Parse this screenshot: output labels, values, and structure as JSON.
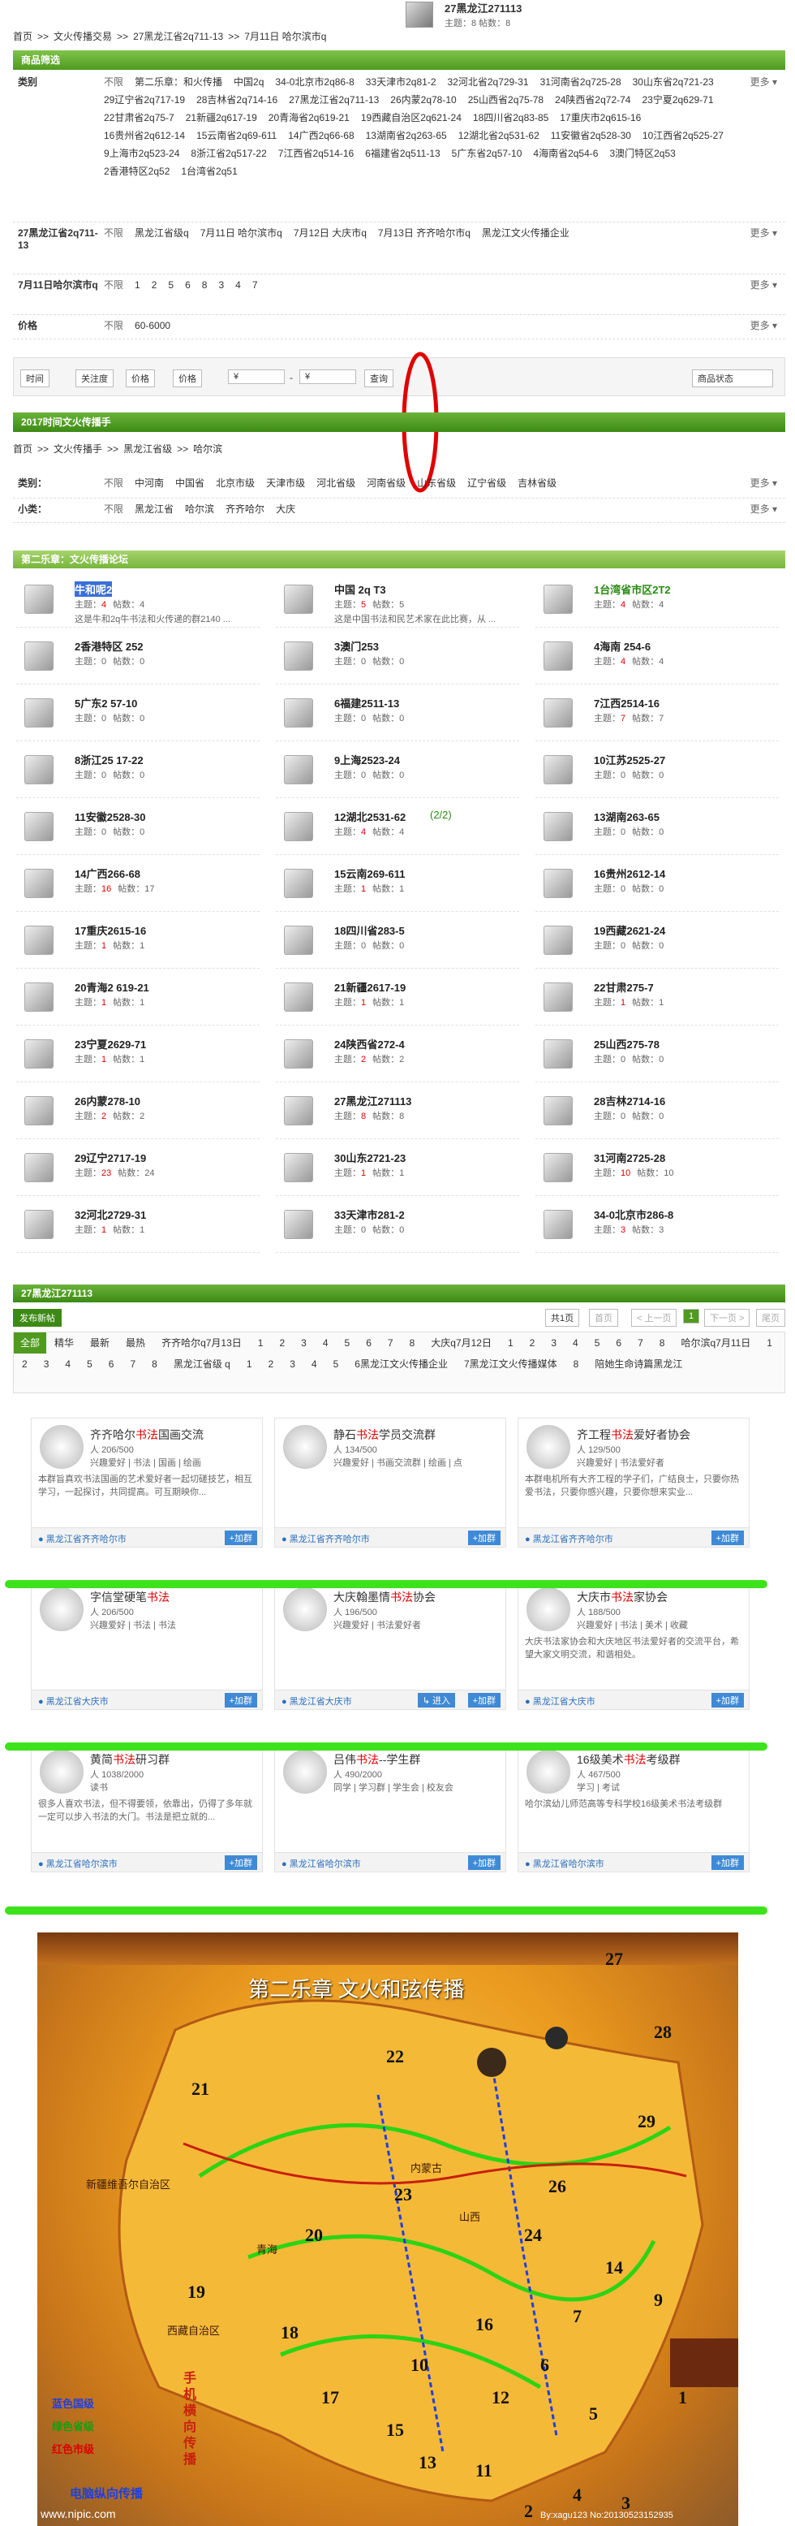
{
  "header": {
    "thread_title": "27黑龙江271113",
    "thread_meta": "主题：8 帖数：8"
  },
  "breadcrumb1": [
    "首页",
    ">>",
    "文火传播交易",
    ">>",
    "27黑龙江省2q711-13",
    ">>",
    "7月11日 哈尔滨市q"
  ],
  "filter_title": "商品筛选",
  "filters": [
    {
      "label": "类别",
      "more": "更多",
      "options": [
        "不限",
        "第二乐章：和火传播",
        "中国2q",
        "34-0北京市2q86-8",
        "33天津市2q81-2",
        "32河北省2q729-31",
        "31河南省2q725-28",
        "30山东省2q721-23",
        "29辽宁省2q717-19",
        "28吉林省2q714-16",
        "27黑龙江省2q711-13",
        "26内蒙2q78-10",
        "25山西省2q75-78",
        "24陕西省2q72-74",
        "23宁夏2q629-71",
        "22甘肃省2q75-7",
        "21新疆2q617-19",
        "20青海省2q619-21",
        "19西藏自治区2q621-24",
        "18四川省2q83-85",
        "17重庆市2q615-16",
        "16贵州省2q612-14",
        "15云南省2q69-611",
        "14广西2q66-68",
        "13湖南省2q263-65",
        "12湖北省2q531-62",
        "11安徽省2q528-30",
        "10江西省2q525-27",
        "9上海市2q523-24",
        "8浙江省2q517-22",
        "7江西省2q514-16",
        "6福建省2q511-13",
        "5广东省2q57-10",
        "4海南省2q54-6",
        "3澳门特区2q53",
        "2香港特区2q52",
        "1台湾省2q51"
      ]
    },
    {
      "label": "27黑龙江省2q711-13",
      "more": "更多",
      "options": [
        "不限",
        "黑龙江省级q",
        "7月11日 哈尔滨市q",
        "7月12日 大庆市q",
        "7月13日 齐齐哈尔市q",
        "黑龙江文火传播企业"
      ]
    },
    {
      "label": "7月11日哈尔滨市q",
      "more": "更多",
      "options": [
        "不限",
        "1",
        "2",
        "5",
        "6",
        "8",
        "3",
        "4",
        "7"
      ]
    },
    {
      "label": "价格",
      "more": "更多",
      "options": [
        "不限",
        "60-6000"
      ]
    }
  ],
  "toolbar": {
    "buttons": [
      "时间",
      "关注度",
      "价格",
      "价格"
    ],
    "price_from": "¥",
    "price_dash": "-",
    "price_to": "¥",
    "query": "查询",
    "status": "商品状态"
  },
  "section2": {
    "title": "2017时间文火传播手",
    "crumbs": [
      "首页",
      ">>",
      "文火传播手",
      ">>",
      "黑龙江省级",
      ">>",
      "哈尔滨"
    ]
  },
  "filters2": [
    {
      "label": "类别：",
      "more": "更多",
      "options": [
        "不限",
        "中河南",
        "中国省",
        "北京市级",
        "天津市级",
        "河北省级",
        "河南省级",
        "山东省级",
        "辽宁省级",
        "吉林省级"
      ]
    },
    {
      "label": "小类：",
      "more": "更多",
      "options": [
        "不限",
        "黑龙江省",
        "哈尔滨",
        "齐齐哈尔",
        "大庆"
      ]
    }
  ],
  "forum_section_title": "第二乐章：文火传播论坛",
  "forums": [
    {
      "name": "牛和呢2",
      "topics": "4",
      "posts": "4",
      "desc": "这是牛和2q牛书法和火传递的群2140 ..."
    },
    {
      "name": "中国 2q T3",
      "topics": "5",
      "posts": "5",
      "desc": "这是中国书法和民艺术家在此比赛，从 ..."
    },
    {
      "name": "1台湾省市区2T2",
      "topics": "4",
      "posts": "4",
      "desc": ""
    },
    {
      "name": "2香港特区 252",
      "topics": "0",
      "posts": "0",
      "desc": ""
    },
    {
      "name": "3澳门253",
      "topics": "0",
      "posts": "0",
      "desc": ""
    },
    {
      "name": "4海南 254-6",
      "topics": "4",
      "posts": "4",
      "desc": ""
    },
    {
      "name": "5广东2 57-10",
      "topics": "0",
      "posts": "0",
      "desc": ""
    },
    {
      "name": "6福建2511-13",
      "topics": "0",
      "posts": "0",
      "desc": ""
    },
    {
      "name": "7江西2514-16",
      "topics": "7",
      "posts": "7",
      "desc": ""
    },
    {
      "name": "8浙江25 17-22",
      "topics": "0",
      "posts": "0",
      "desc": ""
    },
    {
      "name": "9上海2523-24",
      "topics": "0",
      "posts": "0",
      "desc": ""
    },
    {
      "name": "10江苏2525-27",
      "topics": "0",
      "posts": "0",
      "desc": ""
    },
    {
      "name": "11安徽2528-30",
      "topics": "0",
      "posts": "0",
      "desc": ""
    },
    {
      "name": "12湖北2531-62",
      "topics": "4",
      "posts": "4",
      "desc": "",
      "extra": "(2/2)"
    },
    {
      "name": "13湖南263-65",
      "topics": "0",
      "posts": "0",
      "desc": ""
    },
    {
      "name": "14广西266-68",
      "topics": "16",
      "posts": "17",
      "desc": ""
    },
    {
      "name": "15云南269-611",
      "topics": "1",
      "posts": "1",
      "desc": ""
    },
    {
      "name": "16贵州2612-14",
      "topics": "0",
      "posts": "0",
      "desc": ""
    },
    {
      "name": "17重庆2615-16",
      "topics": "1",
      "posts": "1",
      "desc": ""
    },
    {
      "name": "18四川省283-5",
      "topics": "0",
      "posts": "0",
      "desc": ""
    },
    {
      "name": "19西藏2621-24",
      "topics": "0",
      "posts": "0",
      "desc": ""
    },
    {
      "name": "20青海2 619-21",
      "topics": "1",
      "posts": "1",
      "desc": ""
    },
    {
      "name": "21新疆2617-19",
      "topics": "1",
      "posts": "1",
      "desc": ""
    },
    {
      "name": "22甘肃275-7",
      "topics": "1",
      "posts": "1",
      "desc": ""
    },
    {
      "name": "23宁夏2629-71",
      "topics": "1",
      "posts": "1",
      "desc": ""
    },
    {
      "name": "24陕西省272-4",
      "topics": "2",
      "posts": "2",
      "desc": ""
    },
    {
      "name": "25山西275-78",
      "topics": "0",
      "posts": "0",
      "desc": ""
    },
    {
      "name": "26内蒙278-10",
      "topics": "2",
      "posts": "2",
      "desc": ""
    },
    {
      "name": "27黑龙江271113",
      "topics": "8",
      "posts": "8",
      "desc": ""
    },
    {
      "name": "28吉林2714-16",
      "topics": "0",
      "posts": "0",
      "desc": ""
    },
    {
      "name": "29辽宁2717-19",
      "topics": "23",
      "posts": "24",
      "desc": ""
    },
    {
      "name": "30山东2721-23",
      "topics": "1",
      "posts": "1",
      "desc": ""
    },
    {
      "name": "31河南2725-28",
      "topics": "10",
      "posts": "10",
      "desc": ""
    },
    {
      "name": "32河北2729-31",
      "topics": "1",
      "posts": "1",
      "desc": ""
    },
    {
      "name": "33天津市281-2",
      "topics": "0",
      "posts": "0",
      "desc": ""
    },
    {
      "name": "34-0北京市286-8",
      "topics": "3",
      "posts": "3",
      "desc": ""
    }
  ],
  "labels": {
    "topics": "主题：",
    "posts": "帖数："
  },
  "thread_section": {
    "title": "27黑龙江271113",
    "new_post": "发布新帖",
    "total": "共1页",
    "pager": [
      "首页",
      "< 上一页",
      "1",
      "下一页 >",
      "尾页"
    ]
  },
  "thread_tabs": [
    "全部",
    "精华",
    "最新",
    "最热",
    "齐齐哈尔q7月13日",
    "1",
    "2",
    "3",
    "4",
    "5",
    "6",
    "7",
    "8",
    "大庆q7月12日",
    "1",
    "2",
    "3",
    "4",
    "5",
    "6",
    "7",
    "8",
    "哈尔滨q7月11日",
    "1",
    "2",
    "3",
    "4",
    "5",
    "6",
    "7",
    "8",
    "黑龙江省级 q",
    "1",
    "2",
    "3",
    "4",
    "5",
    "6黑龙江文火传播企业",
    "7黑龙江文火传播媒体",
    "8",
    "陪她生命诗篇黑龙江"
  ],
  "groups": [
    {
      "name_pre": "齐齐哈尔",
      "name_hl": "书法",
      "name_post": "国画交流",
      "members": "206/500",
      "tags": "兴趣爱好 | 书法 | 国画 | 绘画",
      "desc": "本群旨真欢书法国画的艺术爱好者一起切磋技艺，相互学习，一起探讨，共同提高。可互期映你...",
      "loc": "黑龙江省齐齐哈尔市",
      "join": "+加群"
    },
    {
      "name_pre": "静石",
      "name_hl": "书法",
      "name_post": "学员交流群",
      "members": "134/500",
      "tags": "兴趣爱好 | 书画交流群 | 绘画 | 点",
      "desc": "",
      "loc": "黑龙江省齐齐哈尔市",
      "join": "+加群"
    },
    {
      "name_pre": "齐工程",
      "name_hl": "书法",
      "name_post": "爱好者协会",
      "members": "129/500",
      "tags": "兴趣爱好 | 书法爱好者",
      "desc": "本群电机所有大齐工程的学子们，广结良士，只要你热爱书法，只要你感兴趣，只要你想来实业...",
      "loc": "黑龙江省齐齐哈尔市",
      "join": "+加群"
    },
    {
      "name_pre": "字信堂硬笔",
      "name_hl": "书法",
      "name_post": "",
      "members": "206/500",
      "tags": "兴趣爱好 | 书法 | 书法",
      "desc": "",
      "loc": "黑龙江省大庆市",
      "join": "+加群"
    },
    {
      "name_pre": "大庆翰墨情",
      "name_hl": "书法",
      "name_post": "协会",
      "members": "196/500",
      "tags": "兴趣爱好 | 书法爱好者",
      "desc": "",
      "loc": "黑龙江省大庆市",
      "join": "+加群",
      "enter": "进入"
    },
    {
      "name_pre": "大庆市",
      "name_hl": "书法",
      "name_post": "家协会",
      "members": "188/500",
      "tags": "兴趣爱好 | 书法 | 美术 | 收藏",
      "desc": "大庆书法家协会和大庆地区书法爱好者的交流平台，希望大家文明交流，和谐相处。",
      "loc": "黑龙江省大庆市",
      "join": "+加群"
    },
    {
      "name_pre": "黄简",
      "name_hl": "书法",
      "name_post": "研习群",
      "members": "1038/2000",
      "tags": "读书",
      "desc": "很多人喜欢书法，但不得要领，依靠出，仍得了多年就一定可以步入书法的大门。书法是把立就的...",
      "loc": "黑龙江省哈尔滨市",
      "join": "+加群"
    },
    {
      "name_pre": "吕伟",
      "name_hl": "书法",
      "name_post": "--学生群",
      "members": "490/2000",
      "tags": "同学 | 学习群 | 学生会 | 校友会",
      "desc": "",
      "loc": "黑龙江省哈尔滨市",
      "join": "+加群"
    },
    {
      "name_pre": "16级美术",
      "name_hl": "书法",
      "name_post": "考级群",
      "members": "467/500",
      "tags": "学习 | 考试",
      "desc": "哈尔滨幼儿师范高等专科学校16级美术书法考级群",
      "loc": "黑龙江省哈尔滨市",
      "join": "+加群"
    }
  ],
  "group_label": {
    "members_prefix": "人"
  },
  "map": {
    "title": "第二乐章 文火和弦传播",
    "legend": [
      "蓝色国级",
      "绿色省级",
      "红色市级"
    ],
    "bottom_left": "电脑纵向传播",
    "watermark": "www.nipic.com",
    "credit": "By:xagu123 No:20130523152935",
    "vertical": "手机横向传播",
    "regions": [
      "新疆维吾尔自治区",
      "西藏自治区",
      "青海",
      "内蒙古",
      "山西"
    ],
    "numbers": [
      "27",
      "28",
      "21",
      "22",
      "19",
      "20",
      "23",
      "26",
      "24",
      "18",
      "17",
      "15",
      "16",
      "12",
      "13",
      "11",
      "10",
      "7",
      "6",
      "5",
      "2",
      "4",
      "3",
      "1",
      "9",
      "29",
      "14"
    ]
  }
}
